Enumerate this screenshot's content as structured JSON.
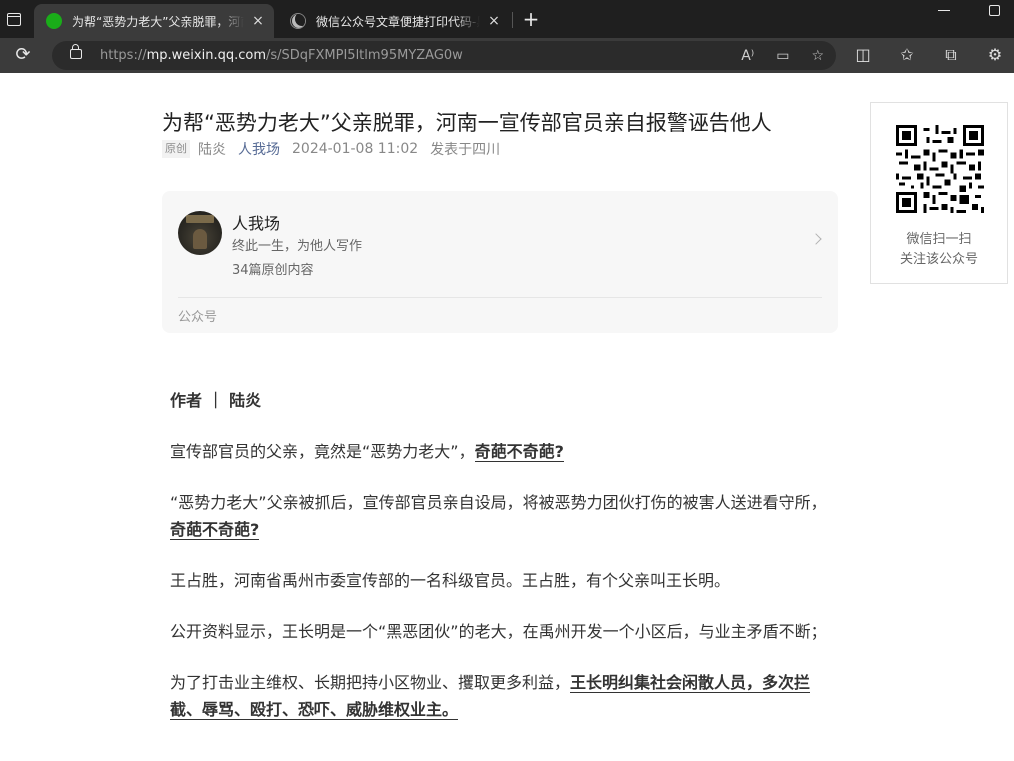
{
  "browser": {
    "tabs": [
      {
        "title": "为帮“恶势力老大”父亲脱罪，河南",
        "active": true,
        "icon": "wechat-icon"
      },
      {
        "title": "微信公众号文章便捷打印代码-黑",
        "active": false,
        "icon": "moon-icon"
      }
    ],
    "new_tab": "+",
    "close_glyph": "×",
    "url_scheme": "https://",
    "url_host": "mp.weixin.qq.com",
    "url_path": "/s/SDqFXMPI5ltlm95MYZAG0w"
  },
  "article": {
    "title": "为帮“恶势力老大”父亲脱罪，河南一宣传部官员亲自报警诬告他人",
    "badge": "原创",
    "author": "陆炎",
    "account": "人我场",
    "date": "2024-01-08 11:02",
    "location": "发表于四川"
  },
  "profile": {
    "name": "人我场",
    "description": "终此一生，为他人写作",
    "count": "34篇原创内容",
    "type": "公众号"
  },
  "qr": {
    "line1": "微信扫一扫",
    "line2": "关注该公众号"
  },
  "content": {
    "byline": "作者 ｜ 陆炎",
    "p1_text": "宣传部官员的父亲，竟然是“恶势力老大”，",
    "p1_bold": "奇葩不奇葩?",
    "p2_text": "“恶势力老大”父亲被抓后，宣传部官员亲自设局，将被恶势力团伙打伤的被害人送进看守所，",
    "p2_bold": "奇葩不奇葩?",
    "p3_text": "王占胜，河南省禹州市委宣传部的一名科级官员。王占胜，有个父亲叫王长明。",
    "p4_text": "公开资料显示，王长明是一个“黑恶团伙”的老大，在禹州开发一个小区后，与业主矛盾不断；",
    "p5_text": "为了打击业主维权、长期把持小区物业、攫取更多利益，",
    "p5_bold": "王长明纠集社会闲散人员，多次拦截、辱骂、殴打、恐吓、威胁维权业主。"
  }
}
